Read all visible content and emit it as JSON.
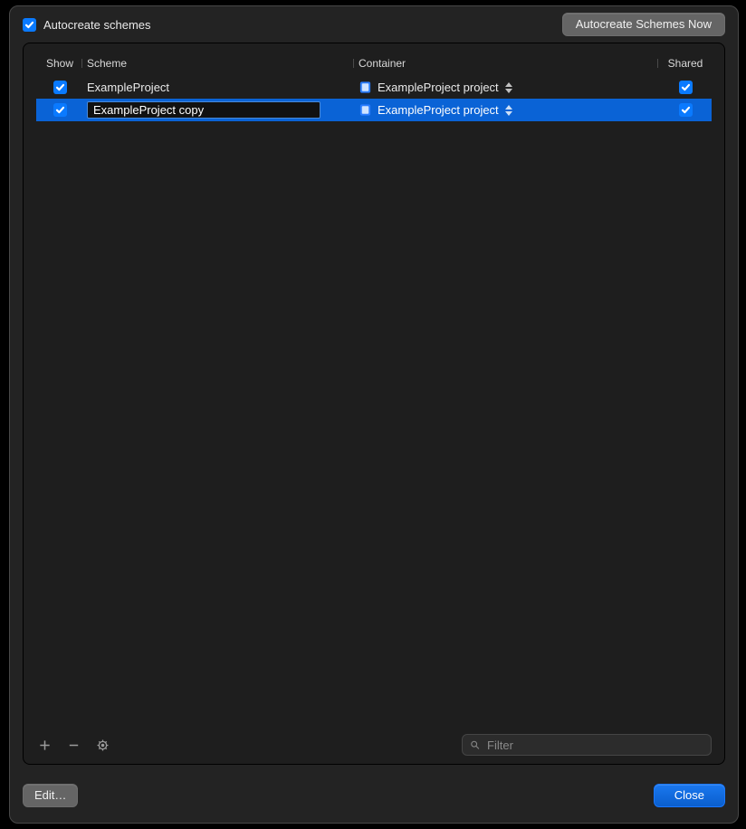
{
  "topbar": {
    "autocreate_label": "Autocreate schemes",
    "autocreate_checked": true,
    "autocreate_now_label": "Autocreate Schemes Now"
  },
  "table": {
    "headers": {
      "show": "Show",
      "scheme": "Scheme",
      "container": "Container",
      "shared": "Shared"
    },
    "rows": [
      {
        "show": true,
        "scheme": "ExampleProject",
        "container": "ExampleProject project",
        "shared": true,
        "selected": false,
        "editing": false
      },
      {
        "show": true,
        "scheme": "ExampleProject copy",
        "container": "ExampleProject project",
        "shared": true,
        "selected": true,
        "editing": true
      }
    ]
  },
  "toolbar": {
    "filter_placeholder": "Filter"
  },
  "footer": {
    "edit_label": "Edit…",
    "close_label": "Close"
  },
  "icons": {
    "project": "project-icon"
  }
}
